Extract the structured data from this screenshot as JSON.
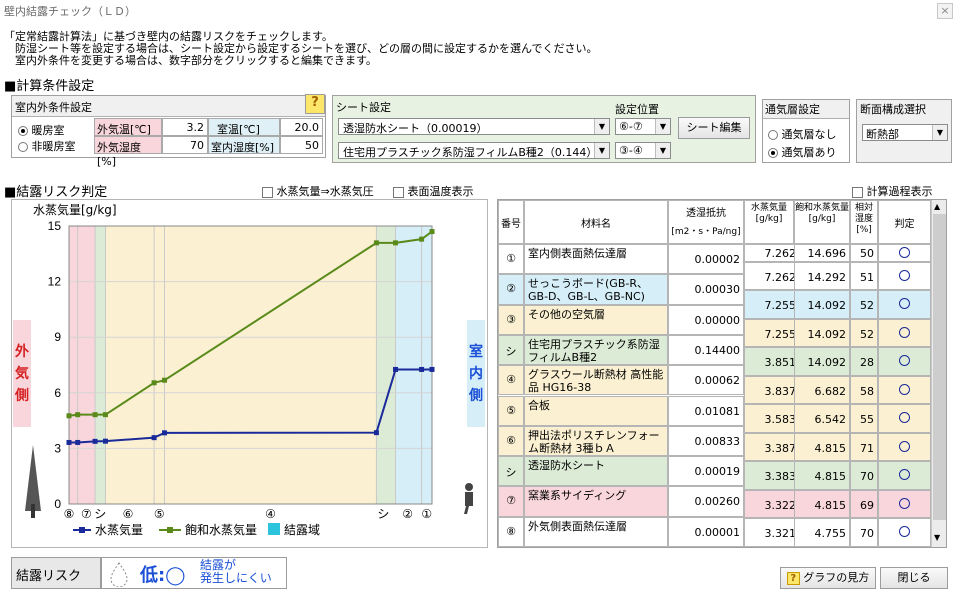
{
  "window": {
    "title": "壁内結露チェック（ＬＤ）",
    "close": "×"
  },
  "intro": [
    "「定常結露計算法」に基づき壁内の結露リスクをチェックします。",
    "　防湿シート等を設定する場合は、シート設定から設定するシートを選び、どの層の間に設定するかを選んでください。",
    "　室内外条件を変更する場合は、数字部分をクリックすると編集できます。"
  ],
  "calc_heading": "■計算条件設定",
  "indoor_outdoor": {
    "title": "室内外条件設定",
    "help": "?",
    "radio_heating": "暖房室",
    "radio_nonheating": "非暖房室",
    "out_temp_label": "外気温[℃]",
    "out_temp": "3.2",
    "room_temp_label": "室温[℃]",
    "room_temp": "20.0",
    "out_hum_label": "外気湿度[%]",
    "out_hum": "70",
    "room_hum_label": "室内湿度[%]",
    "room_hum": "50"
  },
  "sheet": {
    "title": "シート設定",
    "pos_title": "設定位置",
    "sheet1": "透湿防水シート（0.00019）",
    "pos1": "⑥-⑦",
    "sheet2": "住宅用プラスチック系防湿フィルムB種2（0.144）",
    "pos2": "③-④",
    "edit_button": "シート編集"
  },
  "vent": {
    "title": "通気層設定",
    "none": "通気層なし",
    "with": "通気層あり"
  },
  "section": {
    "title": "断面構成選択",
    "value": "断熱部"
  },
  "risk_heading": "■結露リスク判定",
  "options": {
    "vapor_to_pressure": "水蒸気量⇒水蒸気圧",
    "surface_temp": "表面温度表示",
    "calc_process": "計算過程表示"
  },
  "chart_data": {
    "type": "line",
    "ylabel": "水蒸気量[g/kg]",
    "ylim": [
      0,
      15
    ],
    "yticks": [
      0,
      3,
      6,
      9,
      12,
      15
    ],
    "x": [
      0,
      0.5,
      1.5,
      2.1,
      4.9,
      5.5,
      17.7,
      18.8,
      20.3,
      20.9
    ],
    "x_labels": [
      {
        "x": 0.0,
        "label": "⑧"
      },
      {
        "x": 1.0,
        "label": "⑦"
      },
      {
        "x": 1.8,
        "label": "シ"
      },
      {
        "x": 3.4,
        "label": "⑥"
      },
      {
        "x": 5.2,
        "label": "⑤"
      },
      {
        "x": 11.6,
        "label": "④"
      },
      {
        "x": 18.1,
        "label": "シ"
      },
      {
        "x": 19.5,
        "label": "②"
      },
      {
        "x": 20.6,
        "label": "①"
      }
    ],
    "series": [
      {
        "name": "水蒸気量",
        "color": "#1a2a9a",
        "values": [
          3.32,
          3.32,
          3.38,
          3.39,
          3.58,
          3.84,
          3.85,
          7.26,
          7.26,
          7.26
        ]
      },
      {
        "name": "飽和水蒸気量",
        "color": "#5a8a1a",
        "values": [
          4.76,
          4.82,
          4.82,
          4.82,
          6.54,
          6.68,
          14.09,
          14.09,
          14.29,
          14.7
        ]
      }
    ],
    "legend_condense": "結露域"
  },
  "outside_label": "外気側",
  "inside_label": "室内側",
  "table": {
    "headers": {
      "no": "番号",
      "material": "材料名",
      "resist": "透湿抵抗",
      "resist_unit": "[m2・s・Pa/ng]",
      "vapor": "水蒸気量",
      "vapor_unit": "[g/kg]",
      "sat": "飽和水蒸気量",
      "sat_unit": "[g/kg]",
      "rh": "相対湿度",
      "rh_unit": "[%]",
      "judge": "判定"
    },
    "rows": [
      {
        "no": "①",
        "name": "室内側表面熱伝達層",
        "resist": "0.00002",
        "bg": "#ffffff"
      },
      {
        "no": "②",
        "name": "せっこうボード(GB-R、GB-D、GB-L、GB-NC)",
        "resist": "0.00030",
        "bg": "#d6eef8"
      },
      {
        "no": "③",
        "name": "その他の空気層",
        "resist": "0.00000",
        "bg": "#fbf1d2"
      },
      {
        "no": "シ",
        "name": "住宅用プラスチック系防湿フィルムB種2",
        "resist": "0.14400",
        "bg": "#dcebd6"
      },
      {
        "no": "④",
        "name": "グラスウール断熱材 高性能品 HG16-38",
        "resist": "0.00062",
        "bg": "#fbf1d2"
      },
      {
        "no": "⑤",
        "name": "合板",
        "resist": "0.01081",
        "bg": "#fbf1d2"
      },
      {
        "no": "⑥",
        "name": "押出法ポリスチレンフォーム断熱材 3種ｂＡ",
        "resist": "0.00833",
        "bg": "#fbf1d2"
      },
      {
        "no": "シ",
        "name": "透湿防水シート",
        "resist": "0.00019",
        "bg": "#dcebd6"
      },
      {
        "no": "⑦",
        "name": "窯業系サイディング",
        "resist": "0.00260",
        "bg": "#f9d6dc"
      },
      {
        "no": "⑧",
        "name": "外気側表面熱伝達層",
        "resist": "0.00001",
        "bg": "#ffffff"
      }
    ],
    "bounds": [
      {
        "vapor": "7.262",
        "sat": "14.696",
        "rh": "50",
        "bg": "#ffffff"
      },
      {
        "vapor": "7.262",
        "sat": "14.292",
        "rh": "51",
        "bg": "#ffffff"
      },
      {
        "vapor": "7.255",
        "sat": "14.092",
        "rh": "52",
        "bg": "#d6eef8"
      },
      {
        "vapor": "7.255",
        "sat": "14.092",
        "rh": "52",
        "bg": "#fbf1d2"
      },
      {
        "vapor": "3.851",
        "sat": "14.092",
        "rh": "28",
        "bg": "#dcebd6"
      },
      {
        "vapor": "3.837",
        "sat": "6.682",
        "rh": "58",
        "bg": "#fbf1d2"
      },
      {
        "vapor": "3.583",
        "sat": "6.542",
        "rh": "55",
        "bg": "#fbf1d2"
      },
      {
        "vapor": "3.387",
        "sat": "4.815",
        "rh": "71",
        "bg": "#fbf1d2"
      },
      {
        "vapor": "3.383",
        "sat": "4.815",
        "rh": "70",
        "bg": "#dcebd6"
      },
      {
        "vapor": "3.322",
        "sat": "4.815",
        "rh": "69",
        "bg": "#f9d6dc"
      },
      {
        "vapor": "3.321",
        "sat": "4.755",
        "rh": "70",
        "bg": "#ffffff"
      }
    ]
  },
  "risk": {
    "label": "結露リスク",
    "level": "低:◯",
    "desc1": "結露が",
    "desc2": "発生しにくい"
  },
  "buttons": {
    "graph_help": "グラフの見方",
    "close": "閉じる"
  },
  "colors": {
    "vapor": "#1a2a9a",
    "sat": "#5a8a1a",
    "pink": "#f9d6dc",
    "green": "#dcebd6",
    "cream": "#fbf1d2",
    "blue": "#d6eef8",
    "condense": "#2cc4dc"
  }
}
